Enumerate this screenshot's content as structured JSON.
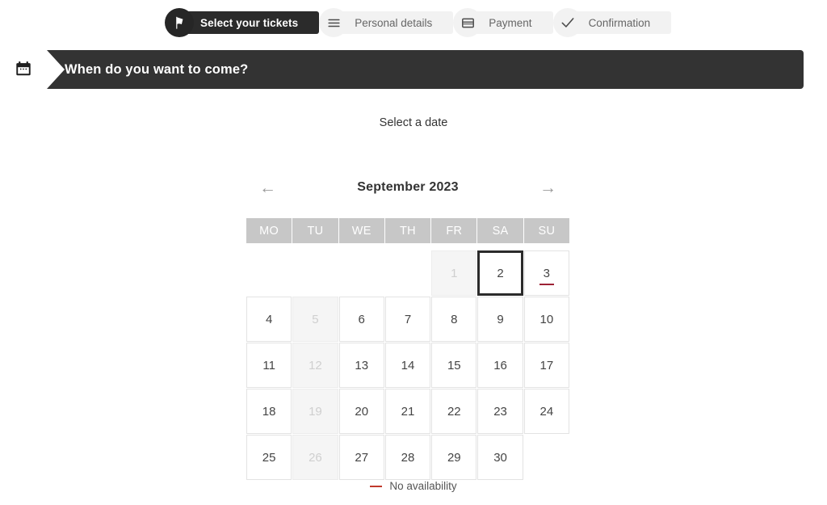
{
  "stepper": {
    "steps": [
      {
        "label": "Select your tickets",
        "icon": "ticket-icon",
        "state": "active"
      },
      {
        "label": "Personal details",
        "icon": "hamburger-menu-icon",
        "state": "inactive"
      },
      {
        "label": "Payment",
        "icon": "credit-card-icon",
        "state": "inactive"
      },
      {
        "label": "Confirmation",
        "icon": "checkmark-icon",
        "state": "inactive"
      }
    ]
  },
  "section": {
    "icon": "calendar-icon",
    "title": "When do you want to come?"
  },
  "main": {
    "select_date_label": "Select a date"
  },
  "calendar": {
    "prev_arrow": "←",
    "next_arrow": "→",
    "month_label": "September 2023",
    "weekdays": [
      "MO",
      "TU",
      "WE",
      "TH",
      "FR",
      "SA",
      "SU"
    ],
    "weeks": [
      [
        {
          "day": "",
          "state": "empty"
        },
        {
          "day": "",
          "state": "empty"
        },
        {
          "day": "",
          "state": "empty"
        },
        {
          "day": "",
          "state": "empty"
        },
        {
          "day": "1",
          "state": "disabled"
        },
        {
          "day": "2",
          "state": "selected"
        },
        {
          "day": "3",
          "state": "no-avail"
        }
      ],
      [
        {
          "day": "4",
          "state": "normal"
        },
        {
          "day": "5",
          "state": "disabled"
        },
        {
          "day": "6",
          "state": "normal"
        },
        {
          "day": "7",
          "state": "normal"
        },
        {
          "day": "8",
          "state": "normal"
        },
        {
          "day": "9",
          "state": "normal"
        },
        {
          "day": "10",
          "state": "normal"
        }
      ],
      [
        {
          "day": "11",
          "state": "normal"
        },
        {
          "day": "12",
          "state": "disabled"
        },
        {
          "day": "13",
          "state": "normal"
        },
        {
          "day": "14",
          "state": "normal"
        },
        {
          "day": "15",
          "state": "normal"
        },
        {
          "day": "16",
          "state": "normal"
        },
        {
          "day": "17",
          "state": "normal"
        }
      ],
      [
        {
          "day": "18",
          "state": "normal"
        },
        {
          "day": "19",
          "state": "disabled"
        },
        {
          "day": "20",
          "state": "normal"
        },
        {
          "day": "21",
          "state": "normal"
        },
        {
          "day": "22",
          "state": "normal"
        },
        {
          "day": "23",
          "state": "normal"
        },
        {
          "day": "24",
          "state": "normal"
        }
      ],
      [
        {
          "day": "25",
          "state": "normal"
        },
        {
          "day": "26",
          "state": "disabled"
        },
        {
          "day": "27",
          "state": "normal"
        },
        {
          "day": "28",
          "state": "normal"
        },
        {
          "day": "29",
          "state": "normal"
        },
        {
          "day": "30",
          "state": "normal"
        },
        {
          "day": "",
          "state": "empty"
        }
      ]
    ]
  },
  "legend": {
    "no_availability_label": "No availability",
    "no_availability_color": "#c0392b"
  },
  "colors": {
    "banner_bg": "#333333",
    "active_step_bg": "#2b2b2b",
    "inactive_step_bg": "#f2f2f2",
    "weekday_header_bg": "#c7c7c7",
    "selected_day_border": "#2b2b2b",
    "no_avail_underline": "#9d2235"
  }
}
